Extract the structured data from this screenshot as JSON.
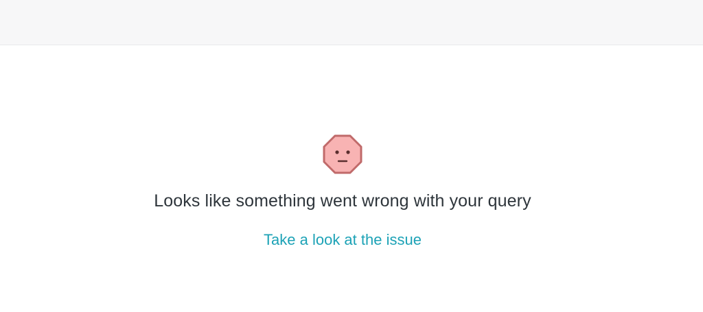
{
  "error": {
    "icon": "sad-octagon-icon",
    "message": "Looks like something went wrong with your query",
    "link_label": "Take a look at the issue"
  },
  "colors": {
    "icon_fill": "#f8b3b3",
    "icon_stroke": "#c06a6a",
    "message_text": "#2e353b",
    "link": "#1ca2b6",
    "topbar_bg": "#f7f7f8"
  }
}
